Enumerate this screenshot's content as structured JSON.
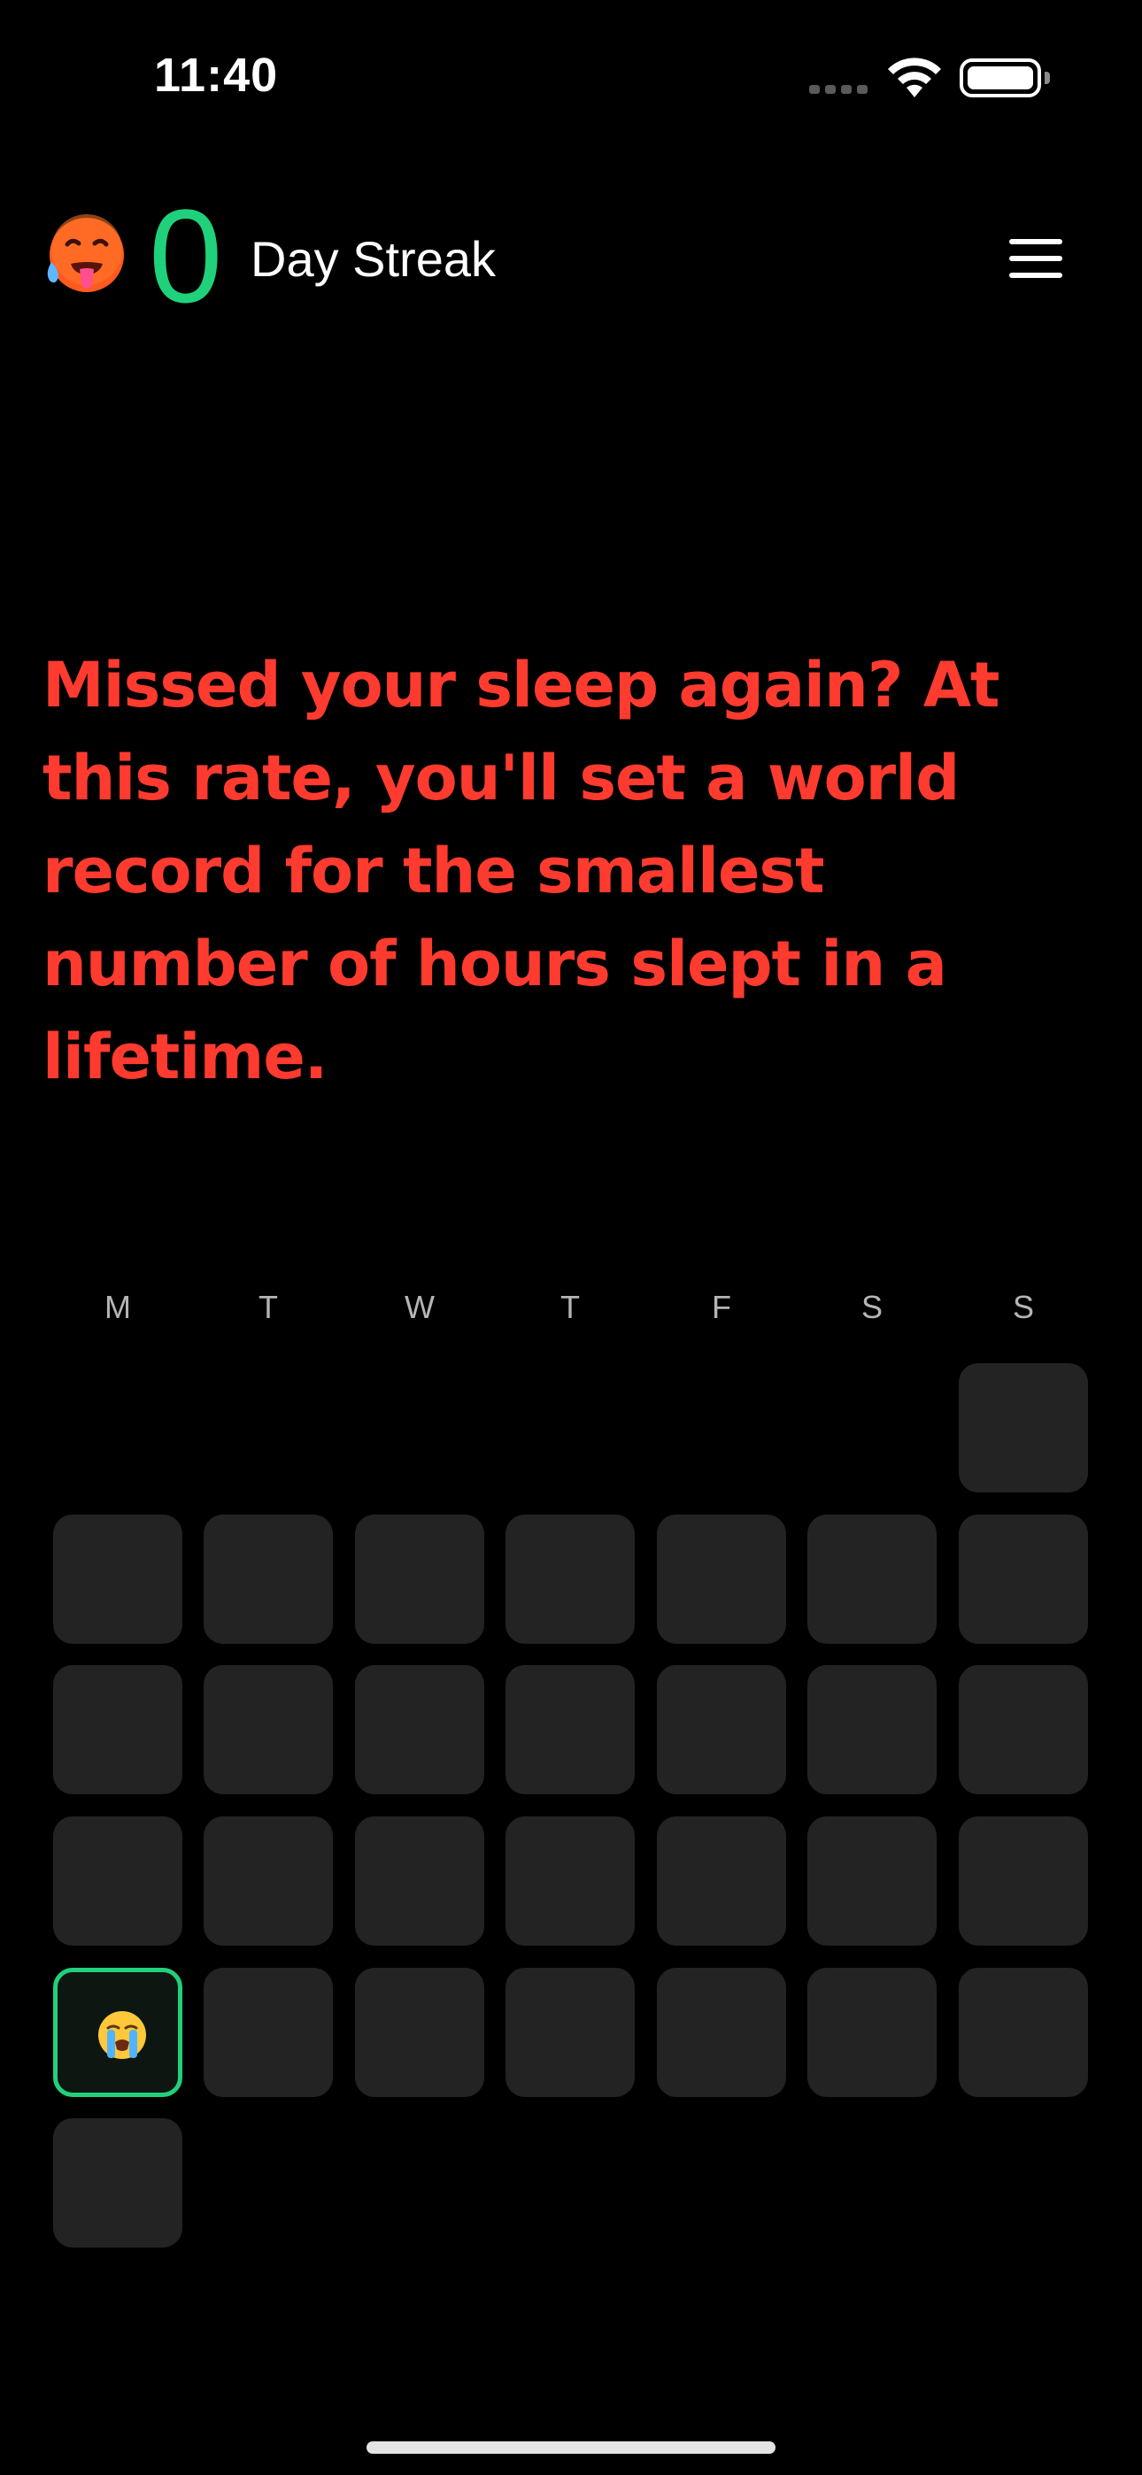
{
  "status_bar": {
    "time": "11:40"
  },
  "header": {
    "emoji_icon": "hot-face-emoji",
    "streak_count": "0",
    "streak_label": "Day Streak",
    "menu_icon": "hamburger-menu-icon"
  },
  "message": "Missed your sleep again? At this rate, you'll set a world record for the smallest number of hours slept in a lifetime.",
  "calendar": {
    "weekdays": [
      "M",
      "T",
      "W",
      "T",
      "F",
      "S",
      "S"
    ],
    "today_emoji_icon": "loudly-crying-face-emoji"
  },
  "colors": {
    "streak": "#1fd17b",
    "message": "#ff3b30",
    "cell": "#232323",
    "today_border": "#22d07c"
  }
}
